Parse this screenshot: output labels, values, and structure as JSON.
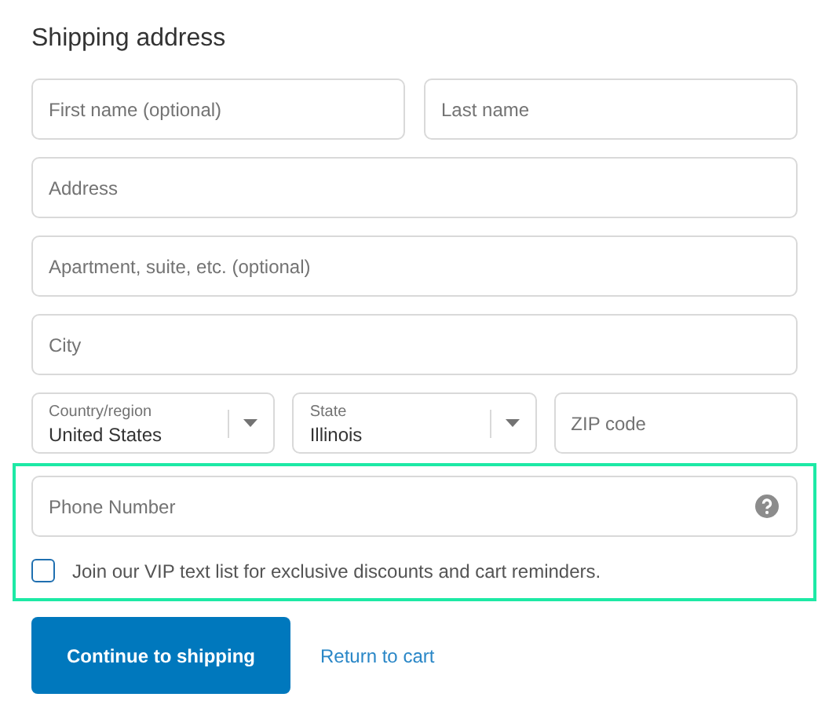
{
  "title": "Shipping address",
  "name_fields": [
    {
      "placeholder": "First name (optional)"
    },
    {
      "placeholder": "Last name"
    }
  ],
  "address_fields": [
    {
      "placeholder": "Address"
    },
    {
      "placeholder": "Apartment, suite, etc. (optional)"
    },
    {
      "placeholder": "City"
    }
  ],
  "selects": [
    {
      "label": "Country/region",
      "value": "United States"
    },
    {
      "label": "State",
      "value": "Illinois"
    }
  ],
  "zip": {
    "placeholder": "ZIP code"
  },
  "sms_section": {
    "highlighted": true,
    "phone": {
      "placeholder": "Phone Number"
    },
    "opt_in": {
      "label": "Join our VIP text list for exclusive discounts and cart reminders.",
      "checked": false
    }
  },
  "primary_button": "Continue to shipping",
  "link": "Return to cart"
}
